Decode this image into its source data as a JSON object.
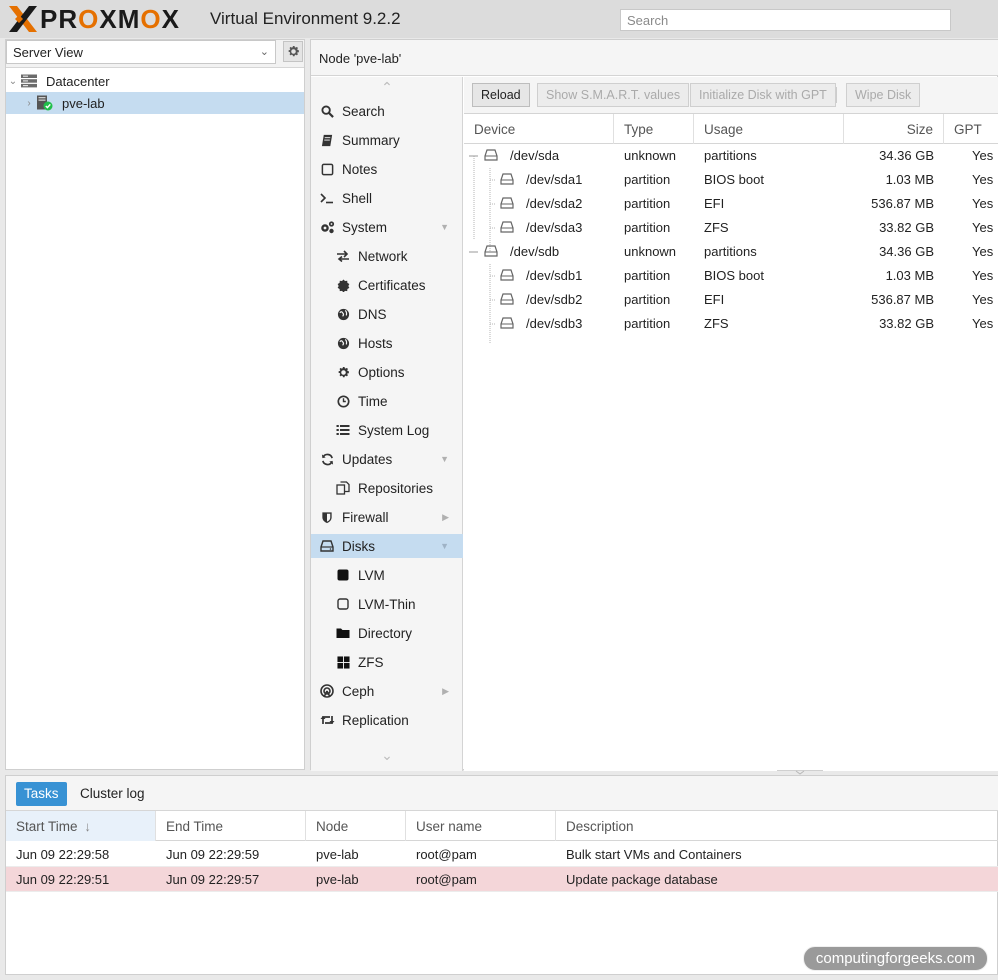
{
  "header": {
    "logo_pre": "PR",
    "logo_o1": "O",
    "logo_mid": "XM",
    "logo_o2": "O",
    "logo_post": "X",
    "title": "Virtual Environment 9.2.2",
    "search_placeholder": "Search"
  },
  "left_panel": {
    "view_select": "Server View",
    "tree": [
      {
        "label": "Datacenter"
      },
      {
        "label": "pve-lab"
      }
    ]
  },
  "content": {
    "title": "Node 'pve-lab'",
    "nav": [
      {
        "label": "Search",
        "icon": "search-icon"
      },
      {
        "label": "Summary",
        "icon": "book-icon"
      },
      {
        "label": "Notes",
        "icon": "note-icon"
      },
      {
        "label": "Shell",
        "icon": "terminal-icon"
      },
      {
        "label": "System",
        "icon": "cogs-icon"
      },
      {
        "label": "Network",
        "icon": "exchange-icon"
      },
      {
        "label": "Certificates",
        "icon": "certificate-icon"
      },
      {
        "label": "DNS",
        "icon": "globe-icon"
      },
      {
        "label": "Hosts",
        "icon": "globe-icon"
      },
      {
        "label": "Options",
        "icon": "gear-icon"
      },
      {
        "label": "Time",
        "icon": "clock-icon"
      },
      {
        "label": "System Log",
        "icon": "list-icon"
      },
      {
        "label": "Updates",
        "icon": "refresh-icon"
      },
      {
        "label": "Repositories",
        "icon": "files-icon"
      },
      {
        "label": "Firewall",
        "icon": "shield-icon"
      },
      {
        "label": "Disks",
        "icon": "hdd-icon"
      },
      {
        "label": "LVM",
        "icon": "square-icon"
      },
      {
        "label": "LVM-Thin",
        "icon": "square-outline-icon"
      },
      {
        "label": "Directory",
        "icon": "folder-icon"
      },
      {
        "label": "ZFS",
        "icon": "th-large-icon"
      },
      {
        "label": "Ceph",
        "icon": "ceph-icon"
      },
      {
        "label": "Replication",
        "icon": "retweet-icon"
      }
    ],
    "toolbar": {
      "reload": "Reload",
      "smart": "Show S.M.A.R.T. values",
      "init_gpt": "Initialize Disk with GPT",
      "wipe": "Wipe Disk"
    },
    "columns": [
      "Device",
      "Type",
      "Usage",
      "Size",
      "GPT"
    ],
    "disks": [
      {
        "device": "/dev/sda",
        "type": "unknown",
        "usage": "partitions",
        "size": "34.36 GB",
        "gpt": "Yes"
      },
      {
        "device": "/dev/sda1",
        "type": "partition",
        "usage": "BIOS boot",
        "size": "1.03 MB",
        "gpt": "Yes"
      },
      {
        "device": "/dev/sda2",
        "type": "partition",
        "usage": "EFI",
        "size": "536.87 MB",
        "gpt": "Yes"
      },
      {
        "device": "/dev/sda3",
        "type": "partition",
        "usage": "ZFS",
        "size": "33.82 GB",
        "gpt": "Yes"
      },
      {
        "device": "/dev/sdb",
        "type": "unknown",
        "usage": "partitions",
        "size": "34.36 GB",
        "gpt": "Yes"
      },
      {
        "device": "/dev/sdb1",
        "type": "partition",
        "usage": "BIOS boot",
        "size": "1.03 MB",
        "gpt": "Yes"
      },
      {
        "device": "/dev/sdb2",
        "type": "partition",
        "usage": "EFI",
        "size": "536.87 MB",
        "gpt": "Yes"
      },
      {
        "device": "/dev/sdb3",
        "type": "partition",
        "usage": "ZFS",
        "size": "33.82 GB",
        "gpt": "Yes"
      }
    ]
  },
  "tasks": {
    "tabs": [
      "Tasks",
      "Cluster log"
    ],
    "columns": [
      "Start Time",
      "End Time",
      "Node",
      "User name",
      "Description"
    ],
    "sort_indicator": "↓",
    "rows": [
      {
        "start": "Jun 09 22:29:58",
        "end": "Jun 09 22:29:59",
        "node": "pve-lab",
        "user": "root@pam",
        "desc": "Bulk start VMs and Containers"
      },
      {
        "start": "Jun 09 22:29:51",
        "end": "Jun 09 22:29:57",
        "node": "pve-lab",
        "user": "root@pam",
        "desc": "Update package database"
      }
    ]
  },
  "watermark": "computingforgeeks.com",
  "colors": {
    "accent": "#3892d4",
    "selection": "#c5dcf0",
    "error_row": "#f4d6d9",
    "logo_orange": "#e57000"
  }
}
